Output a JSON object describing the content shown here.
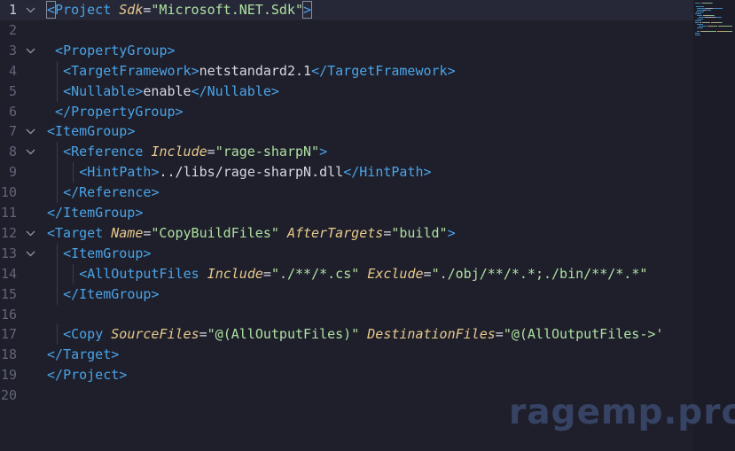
{
  "editor": {
    "current_line": 1,
    "lines": [
      {
        "num": "1",
        "fold": true,
        "indent": 0,
        "tokens": [
          [
            "br",
            "<"
          ],
          [
            "tag",
            "Project"
          ],
          [
            "txt",
            " "
          ],
          [
            "attr",
            "Sdk"
          ],
          [
            "eq",
            "="
          ],
          [
            "str",
            "\"Microsoft.NET.Sdk\""
          ],
          [
            "br",
            ">"
          ]
        ]
      },
      {
        "num": "2",
        "fold": false,
        "indent": 0,
        "tokens": []
      },
      {
        "num": "3",
        "fold": true,
        "indent": 1,
        "tokens": [
          [
            "br",
            "<"
          ],
          [
            "tag",
            "PropertyGroup"
          ],
          [
            "br",
            ">"
          ]
        ]
      },
      {
        "num": "4",
        "fold": false,
        "indent": 2,
        "tokens": [
          [
            "br",
            "<"
          ],
          [
            "tag",
            "TargetFramework"
          ],
          [
            "br",
            ">"
          ],
          [
            "txt",
            "netstandard2.1"
          ],
          [
            "br",
            "</"
          ],
          [
            "tag",
            "TargetFramework"
          ],
          [
            "br",
            ">"
          ]
        ]
      },
      {
        "num": "5",
        "fold": false,
        "indent": 2,
        "tokens": [
          [
            "br",
            "<"
          ],
          [
            "tag",
            "Nullable"
          ],
          [
            "br",
            ">"
          ],
          [
            "txt",
            "enable"
          ],
          [
            "br",
            "</"
          ],
          [
            "tag",
            "Nullable"
          ],
          [
            "br",
            ">"
          ]
        ]
      },
      {
        "num": "6",
        "fold": false,
        "indent": 1,
        "tokens": [
          [
            "br",
            "</"
          ],
          [
            "tag",
            "PropertyGroup"
          ],
          [
            "br",
            ">"
          ]
        ]
      },
      {
        "num": "7",
        "fold": true,
        "indent": 0,
        "tokens": [
          [
            "br",
            "<"
          ],
          [
            "tag",
            "ItemGroup"
          ],
          [
            "br",
            ">"
          ]
        ]
      },
      {
        "num": "8",
        "fold": true,
        "indent": 2,
        "tokens": [
          [
            "br",
            "<"
          ],
          [
            "tag",
            "Reference"
          ],
          [
            "txt",
            " "
          ],
          [
            "attr",
            "Include"
          ],
          [
            "eq",
            "="
          ],
          [
            "str",
            "\"rage-sharpN\""
          ],
          [
            "br",
            ">"
          ]
        ]
      },
      {
        "num": "9",
        "fold": false,
        "indent": 4,
        "tokens": [
          [
            "br",
            "<"
          ],
          [
            "tag",
            "HintPath"
          ],
          [
            "br",
            ">"
          ],
          [
            "txt",
            "../libs/rage-sharpN.dll"
          ],
          [
            "br",
            "</"
          ],
          [
            "tag",
            "HintPath"
          ],
          [
            "br",
            ">"
          ]
        ]
      },
      {
        "num": "10",
        "fold": false,
        "indent": 2,
        "tokens": [
          [
            "br",
            "</"
          ],
          [
            "tag",
            "Reference"
          ],
          [
            "br",
            ">"
          ]
        ]
      },
      {
        "num": "11",
        "fold": false,
        "indent": 0,
        "tokens": [
          [
            "br",
            "</"
          ],
          [
            "tag",
            "ItemGroup"
          ],
          [
            "br",
            ">"
          ]
        ]
      },
      {
        "num": "12",
        "fold": true,
        "indent": 0,
        "tokens": [
          [
            "br",
            "<"
          ],
          [
            "tag",
            "Target"
          ],
          [
            "txt",
            " "
          ],
          [
            "attr",
            "Name"
          ],
          [
            "eq",
            "="
          ],
          [
            "str",
            "\"CopyBuildFiles\""
          ],
          [
            "txt",
            " "
          ],
          [
            "attr",
            "AfterTargets"
          ],
          [
            "eq",
            "="
          ],
          [
            "str",
            "\"build\""
          ],
          [
            "br",
            ">"
          ]
        ]
      },
      {
        "num": "13",
        "fold": true,
        "indent": 2,
        "tokens": [
          [
            "br",
            "<"
          ],
          [
            "tag",
            "ItemGroup"
          ],
          [
            "br",
            ">"
          ]
        ]
      },
      {
        "num": "14",
        "fold": false,
        "indent": 4,
        "tokens": [
          [
            "br",
            "<"
          ],
          [
            "tag",
            "AllOutputFiles"
          ],
          [
            "txt",
            " "
          ],
          [
            "attr",
            "Include"
          ],
          [
            "eq",
            "="
          ],
          [
            "str",
            "\"./**/*.cs\""
          ],
          [
            "txt",
            " "
          ],
          [
            "attr",
            "Exclude"
          ],
          [
            "eq",
            "="
          ],
          [
            "str",
            "\"./obj/**/*.*;./bin/**/*.*\""
          ]
        ]
      },
      {
        "num": "15",
        "fold": false,
        "indent": 2,
        "tokens": [
          [
            "br",
            "</"
          ],
          [
            "tag",
            "ItemGroup"
          ],
          [
            "br",
            ">"
          ]
        ]
      },
      {
        "num": "16",
        "fold": false,
        "indent": 0,
        "tokens": []
      },
      {
        "num": "17",
        "fold": false,
        "indent": 2,
        "tokens": [
          [
            "br",
            "<"
          ],
          [
            "tag",
            "Copy"
          ],
          [
            "txt",
            " "
          ],
          [
            "attr",
            "SourceFiles"
          ],
          [
            "eq",
            "="
          ],
          [
            "str",
            "\"@(AllOutputFiles)\""
          ],
          [
            "txt",
            " "
          ],
          [
            "attr",
            "DestinationFiles"
          ],
          [
            "eq",
            "="
          ],
          [
            "str",
            "\"@(AllOutputFiles->'"
          ]
        ]
      },
      {
        "num": "18",
        "fold": false,
        "indent": 0,
        "tokens": [
          [
            "br",
            "</"
          ],
          [
            "tag",
            "Target"
          ],
          [
            "br",
            ">"
          ]
        ]
      },
      {
        "num": "19",
        "fold": false,
        "indent": 0,
        "tokens": [
          [
            "br",
            "</"
          ],
          [
            "tag",
            "Project"
          ],
          [
            "br",
            ">"
          ]
        ]
      },
      {
        "num": "20",
        "fold": false,
        "indent": 0,
        "tokens": []
      }
    ]
  },
  "colors": {
    "background": "#1e1f2b",
    "tag": "#4aa4e8",
    "attribute": "#e8c98b",
    "string": "#aee0a0",
    "text": "#d7d8df",
    "line_number": "#626576"
  },
  "watermark": {
    "text": "ragemp.pro"
  }
}
